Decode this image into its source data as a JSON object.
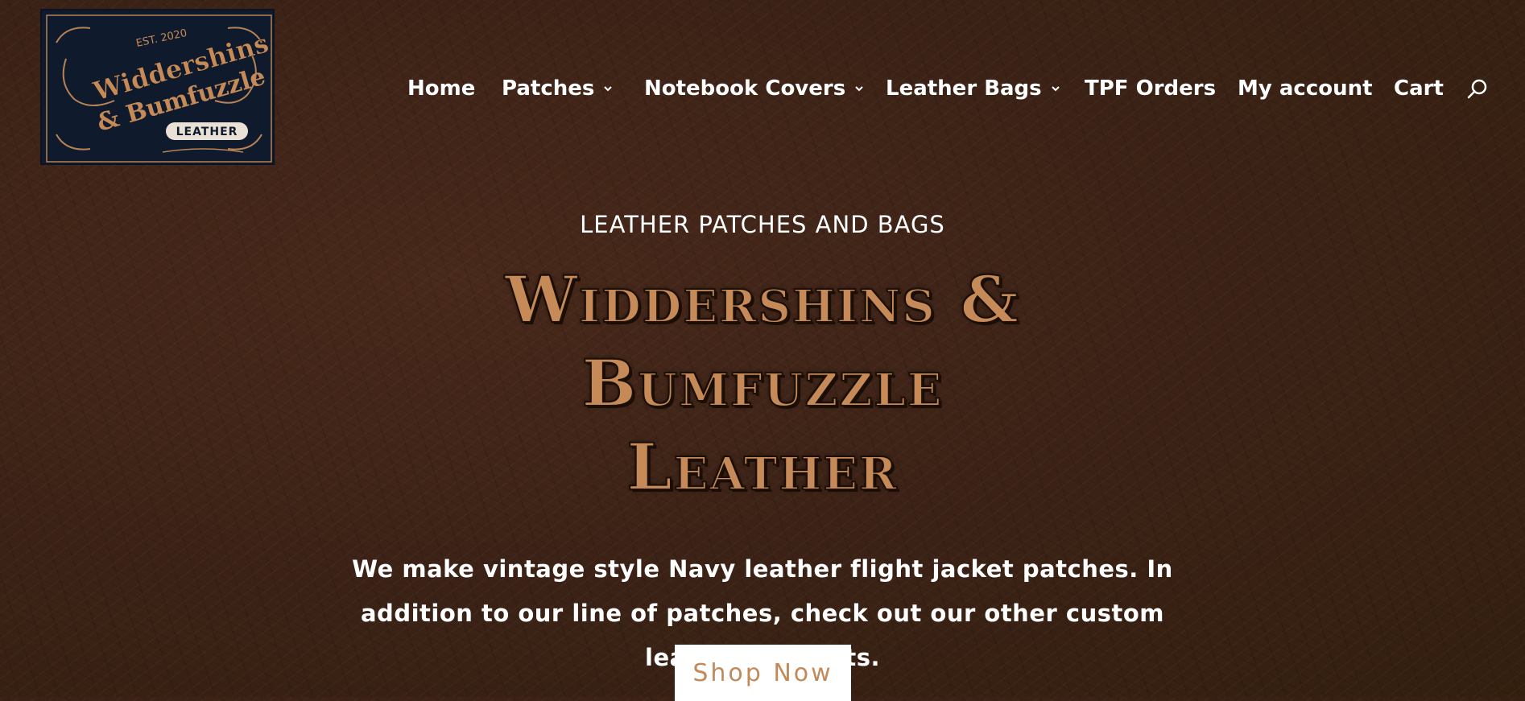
{
  "logo": {
    "est": "EST. 2020",
    "line1": "Widdershins",
    "line2": "& Bumfuzzle",
    "badge": "LEATHER"
  },
  "nav": {
    "items": [
      {
        "label": "Home",
        "has_dropdown": false
      },
      {
        "label": "Patches",
        "has_dropdown": true
      },
      {
        "label": "Notebook Covers",
        "has_dropdown": true
      },
      {
        "label": "Leather Bags",
        "has_dropdown": true
      },
      {
        "label": "TPF Orders",
        "has_dropdown": false
      },
      {
        "label": "My account",
        "has_dropdown": false
      },
      {
        "label": "Cart",
        "has_dropdown": false
      }
    ],
    "search_icon": "search-icon"
  },
  "hero": {
    "eyebrow": "LEATHER PATCHES AND BAGS",
    "headline": [
      "Widdershins &",
      "Bumfuzzle",
      "Leather"
    ],
    "description": "We make vintage style Navy leather flight jacket patches. In addition to our line of patches, check out our other custom leather products.",
    "button_label": "Shop Now"
  },
  "colors": {
    "background": "#3b2216",
    "accent": "#c58a57",
    "logo_bg": "#0f1b2c",
    "text": "#ffffff"
  }
}
